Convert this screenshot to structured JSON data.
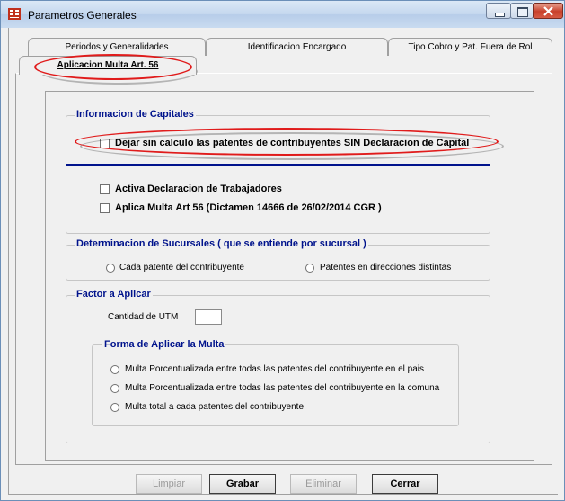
{
  "window": {
    "title": "Parametros Generales"
  },
  "tabs": [
    {
      "label": "Periodos y Generalidades"
    },
    {
      "label": "Identificacion Encargado"
    },
    {
      "label": "Tipo Cobro  y Pat. Fuera de Rol"
    },
    {
      "label": "Aplicacion Multa Art. 56",
      "active": true
    }
  ],
  "capitales": {
    "title": "Informacion de Capitales",
    "items": [
      {
        "label": "Dejar sin calculo las patentes de contribuyentes SIN Declaracion de Capital",
        "checked": false
      },
      {
        "label": "Activa Declaracion de Trabajadores",
        "checked": false
      },
      {
        "label": "Aplica Multa Art 56   (Dictamen 14666 de 26/02/2014 CGR )",
        "checked": false
      }
    ]
  },
  "sucursales": {
    "title": "Determinacion de Sucursales  ( que se entiende por sucursal )",
    "options": [
      {
        "label": "Cada patente del contribuyente",
        "selected": false
      },
      {
        "label": "Patentes en direcciones distintas",
        "selected": false
      }
    ]
  },
  "factor": {
    "title": "Factor a Aplicar",
    "utm_label": "Cantidad de UTM",
    "utm_value": ""
  },
  "forma": {
    "title": "Forma de Aplicar la Multa",
    "options": [
      {
        "label": "Multa Porcentualizada entre todas las patentes del contribuyente en el pais",
        "selected": false
      },
      {
        "label": "Multa Porcentualizada entre todas las patentes del contribuyente en la comuna",
        "selected": false
      },
      {
        "label": "Multa total a cada patentes del contribuyente",
        "selected": false
      }
    ]
  },
  "buttons": {
    "limpiar": "Limpiar",
    "grabar": "Grabar",
    "eliminar": "Eliminar",
    "cerrar": "Cerrar"
  },
  "colors": {
    "group_title": "#00138c",
    "annotation": "#e01b1b"
  }
}
